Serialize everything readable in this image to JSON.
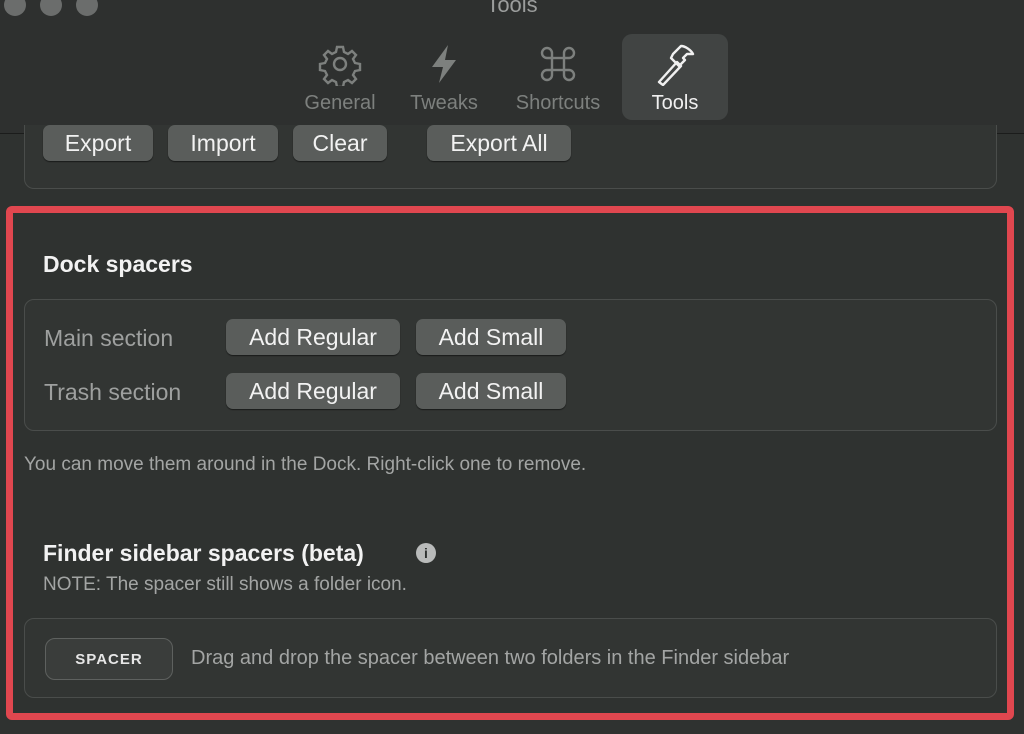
{
  "window": {
    "title": "Tools"
  },
  "tabs": [
    {
      "label": "General",
      "icon": "gear-icon"
    },
    {
      "label": "Tweaks",
      "icon": "bolt-icon"
    },
    {
      "label": "Shortcuts",
      "icon": "command-icon"
    },
    {
      "label": "Tools",
      "icon": "hammer-icon",
      "active": true
    }
  ],
  "top_actions": {
    "export": "Export",
    "import": "Import",
    "clear": "Clear",
    "export_all": "Export All"
  },
  "dock_spacers": {
    "title": "Dock spacers",
    "rows": [
      {
        "label": "Main section",
        "add_regular": "Add Regular",
        "add_small": "Add Small"
      },
      {
        "label": "Trash section",
        "add_regular": "Add Regular",
        "add_small": "Add Small"
      }
    ],
    "hint": "You can move them around in the Dock. Right-click one to remove."
  },
  "finder_spacers": {
    "title": "Finder sidebar spacers (beta)",
    "info_icon": "i",
    "note": "NOTE: The spacer still shows a folder icon.",
    "spacer_label": "SPACER",
    "drag_text": "Drag and drop the spacer between two folders in the Finder sidebar"
  },
  "colors": {
    "highlight": "#e0474f",
    "background": "#2f3230",
    "button": "#5a5d5b"
  }
}
